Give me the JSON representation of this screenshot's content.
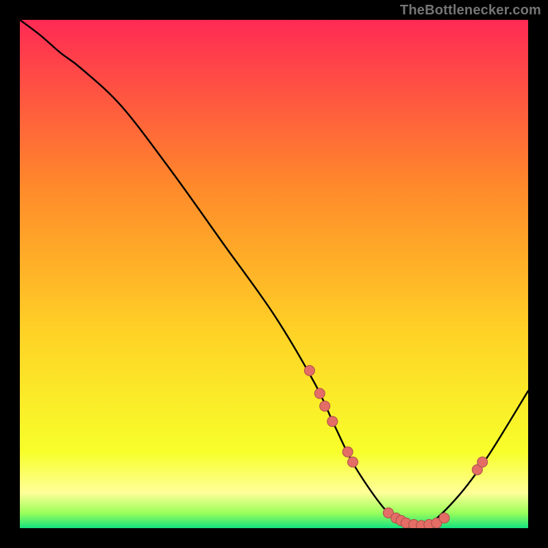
{
  "watermark": "TheBottlenecker.com",
  "chart_data": {
    "type": "line",
    "title": "",
    "xlabel": "",
    "ylabel": "",
    "xlim": [
      0,
      100
    ],
    "ylim": [
      0,
      100
    ],
    "series": [
      {
        "name": "curve",
        "x": [
          0,
          4,
          8,
          12,
          20,
          30,
          40,
          50,
          58,
          62,
          66,
          72,
          76,
          80,
          86,
          92,
          100
        ],
        "y": [
          100,
          97,
          93.5,
          90.5,
          83,
          70,
          56,
          42,
          28.5,
          20,
          12,
          3.5,
          1,
          0.5,
          6,
          14,
          27
        ]
      }
    ],
    "scatter_points": [
      {
        "x": 57,
        "y": 31
      },
      {
        "x": 59,
        "y": 26.5
      },
      {
        "x": 60,
        "y": 24
      },
      {
        "x": 61.5,
        "y": 21
      },
      {
        "x": 64.5,
        "y": 15
      },
      {
        "x": 65.5,
        "y": 13
      },
      {
        "x": 72.5,
        "y": 3
      },
      {
        "x": 74,
        "y": 2
      },
      {
        "x": 75,
        "y": 1.5
      },
      {
        "x": 76,
        "y": 1
      },
      {
        "x": 77.5,
        "y": 0.7
      },
      {
        "x": 79,
        "y": 0.5
      },
      {
        "x": 80.5,
        "y": 0.7
      },
      {
        "x": 82,
        "y": 1
      },
      {
        "x": 83.5,
        "y": 2
      },
      {
        "x": 90,
        "y": 11.5
      },
      {
        "x": 91,
        "y": 13
      }
    ],
    "background_gradient": {
      "top": "#ff2a54",
      "mid1": "#ff6a3a",
      "mid2": "#ffd326",
      "mid3": "#f7ff2a",
      "band": "#ffff99",
      "bottom": "#14e27f"
    },
    "dot_style": {
      "fill": "#e46d66",
      "stroke": "#a84e48",
      "radius": 7.5
    }
  }
}
